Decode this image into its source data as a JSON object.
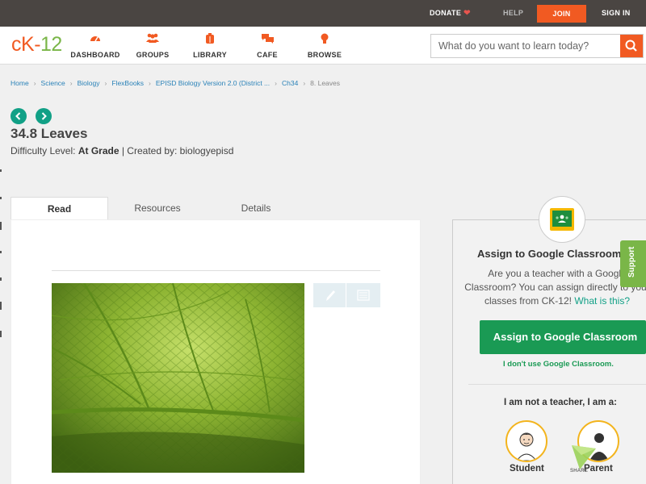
{
  "topbar": {
    "donate": "DONATE",
    "help": "HELP",
    "join": "JOIN",
    "signin": "SIGN IN"
  },
  "header": {
    "logo_ck": "cK",
    "logo_dash": "-",
    "logo_12": "12",
    "nav": {
      "dashboard": "DASHBOARD",
      "groups": "GROUPS",
      "library": "LIBRARY",
      "cafe": "CAFE",
      "browse": "BROWSE"
    },
    "search_placeholder": "What do you want to learn today?"
  },
  "breadcrumb": [
    "Home",
    "Science",
    "Biology",
    "FlexBooks",
    "EPISD Biology Version 2.0 (District ...",
    "Ch34",
    "8. Leaves"
  ],
  "lesson": {
    "title": "34.8 Leaves",
    "difficulty_label": "Difficulty Level:",
    "difficulty_value": "At Grade",
    "created_by": "| Created by: biologyepisd"
  },
  "tabs": [
    "Read",
    "Resources",
    "Details"
  ],
  "panel": {
    "title": "Assign to Google Classroom",
    "desc": "Are you a teacher with a Google Classroom? You can assign directly to your classes from CK-12!",
    "what_link": "What is this?",
    "assign_button": "Assign to Google Classroom",
    "no_gc": "I don't use Google Classroom.",
    "not_teacher": "I am not a teacher, I am a:",
    "student": "Student",
    "parent": "Parent"
  },
  "support": "Support",
  "share": "SHARE",
  "colors": {
    "accent": "#f15a22",
    "green": "#7ab648",
    "teal": "#11a086",
    "gc_green": "#1a9a54"
  }
}
